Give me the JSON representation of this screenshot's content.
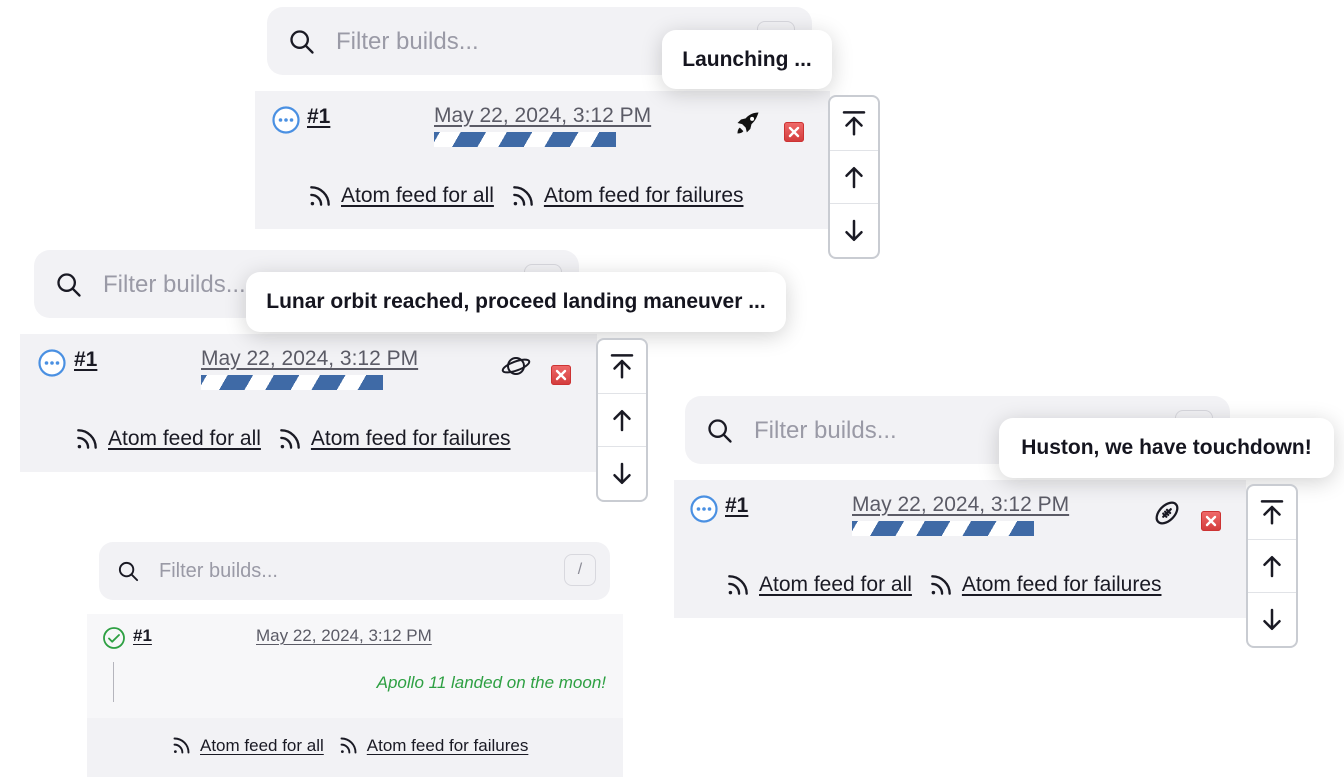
{
  "search": {
    "placeholder": "Filter builds...",
    "shortcut": "/"
  },
  "build": {
    "number": "#1",
    "date": "May 22, 2024, 3:12 PM"
  },
  "feeds": {
    "all": "Atom feed for all",
    "failures": "Atom feed for failures"
  },
  "tooltips": {
    "launch": "Launching ...",
    "orbit": "Lunar orbit reached, proceed landing maneuver ...",
    "touchdown": "Huston, we have touchdown!"
  },
  "result_note": "Apollo 11 landed on the moon!",
  "progress_percent": 60,
  "colors": {
    "progress": "#3f6aa6",
    "success": "#2ea043",
    "running": "#4a90e2",
    "stop": "#d23b3b"
  },
  "icons": {
    "search": "search-icon",
    "rss": "rss-icon",
    "running": "spinner-dots-icon",
    "success": "check-circle-icon",
    "rocket": "rocket-icon",
    "planet": "planet-icon",
    "football": "football-icon",
    "stop": "stop-icon",
    "top": "scroll-top-icon",
    "up": "arrow-up-icon",
    "down": "arrow-down-icon"
  }
}
